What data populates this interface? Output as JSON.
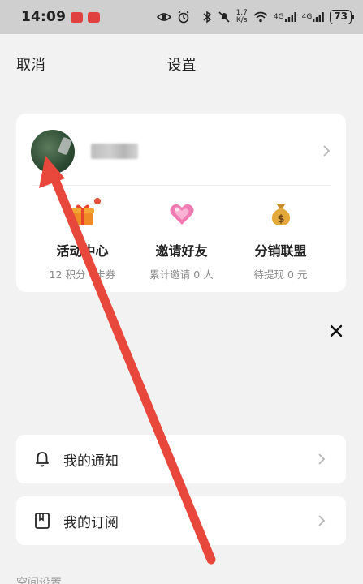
{
  "status_bar": {
    "time": "14:09",
    "network_speed_top": "1.7",
    "network_speed_bottom": "K/s",
    "signal_1": "4G",
    "signal_2": "4G",
    "battery": "73"
  },
  "header": {
    "cancel_label": "取消",
    "title": "设置"
  },
  "profile": {
    "avatar_icon": "avatar-image"
  },
  "features": [
    {
      "name": "活动中心",
      "subtitle": "12 积分 · 卡券",
      "icon": "gift-icon",
      "has_badge": true
    },
    {
      "name": "邀请好友",
      "subtitle": "累计邀请 0 人",
      "icon": "heart-icon",
      "has_badge": false
    },
    {
      "name": "分销联盟",
      "subtitle": "待提现 0 元",
      "icon": "money-bag-icon",
      "has_badge": false
    }
  ],
  "menu": [
    {
      "label": "我的通知",
      "icon": "bell-icon"
    },
    {
      "label": "我的订阅",
      "icon": "bookmark-icon"
    }
  ],
  "section_label": "空间设置",
  "colors": {
    "annotation_arrow": "#e8473b",
    "badge": "#e64c3c"
  }
}
